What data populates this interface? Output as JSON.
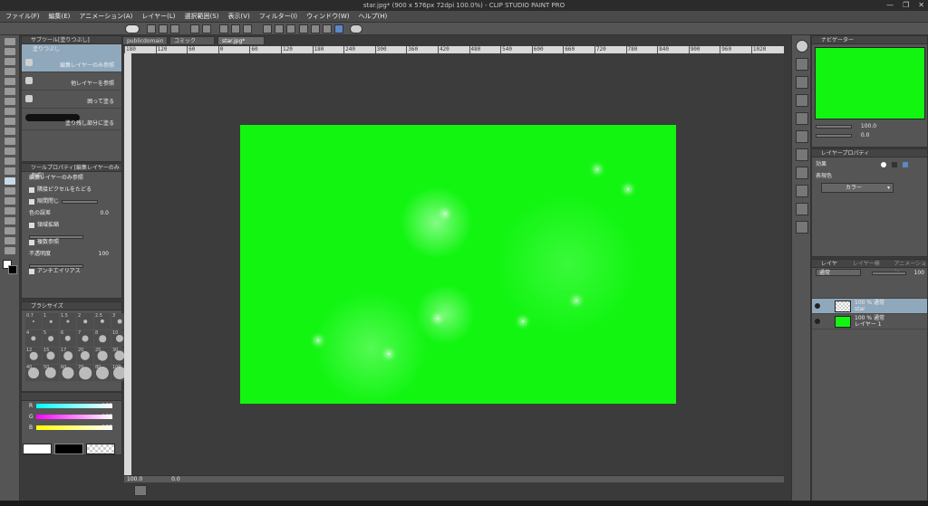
{
  "window": {
    "title": "star.jpg* (900 x 576px 72dpi 100.0%)  - CLIP STUDIO PAINT PRO",
    "minimize": "—",
    "maximize": "❐",
    "close": "✕"
  },
  "menu": [
    "ファイル(F)",
    "編集(E)",
    "アニメーション(A)",
    "レイヤー(L)",
    "選択範囲(S)",
    "表示(V)",
    "フィルター(I)",
    "ウィンドウ(W)",
    "ヘルプ(H)"
  ],
  "tabs": [
    "publicdomain",
    "コミック",
    "star.jpg*"
  ],
  "subtool_panel": {
    "header": "サブツール[塗りつぶし]",
    "group_tab": "塗りつぶし",
    "items": [
      "編集レイヤーのみ参照",
      "他レイヤーを参照",
      "囲って塗る",
      "塗り残し部分に塗る"
    ]
  },
  "tool_property": {
    "header": "ツールプロパティ[編集レイヤーのみ参照]",
    "name": "編集レイヤーのみ参照",
    "rows": {
      "contiguous": "隣接ピクセルをたどる",
      "close_gap": "隙間閉じ",
      "tolerance_label": "色の誤差",
      "tolerance_value": "0.0",
      "expand": "領域拡縮",
      "multi_ref": "複数参照",
      "opacity_label": "不透明度",
      "opacity_value": "100",
      "antialias": "アンチエイリアス"
    }
  },
  "brush_size": {
    "header": "ブラシサイズ",
    "sizes": [
      "0.7",
      "1",
      "1.5",
      "2",
      "2.5",
      "3",
      "4",
      "5",
      "6",
      "7",
      "8",
      "10",
      "12",
      "15",
      "17",
      "20",
      "25",
      "30",
      "40",
      "50",
      "60",
      "70",
      "80",
      "100"
    ]
  },
  "color_slider": {
    "r_label": "R",
    "r_value": "255",
    "g_label": "G",
    "g_value": "255",
    "b_label": "B",
    "b_value": "255"
  },
  "navigator": {
    "header": "ナビゲーター",
    "zoom": "100.0",
    "angle": "0.0"
  },
  "layer_property": {
    "header": "レイヤープロパティ",
    "effect_label": "効果",
    "expression_label": "表現色",
    "expression_value": "カラー"
  },
  "layers_panel": {
    "header": "レイヤー",
    "tab2": "レイヤー検索",
    "tab3": "アニメーション",
    "blend_mode": "通常",
    "opacity": "100",
    "layers": [
      {
        "mode": "100 % 通常",
        "name": "star"
      },
      {
        "mode": "100 % 通常",
        "name": "レイヤー 1"
      }
    ]
  },
  "status": {
    "zoom": "100.0",
    "angle": "0.0"
  },
  "rulers": {
    "ticks": [
      "180",
      "120",
      "60",
      "0",
      "60",
      "120",
      "180",
      "240",
      "300",
      "360",
      "420",
      "480",
      "540",
      "600",
      "660",
      "720",
      "780",
      "840",
      "900",
      "960",
      "1020"
    ]
  },
  "colors": {
    "image_green": "#11f511",
    "selection_blue": "#8fa8bc"
  }
}
